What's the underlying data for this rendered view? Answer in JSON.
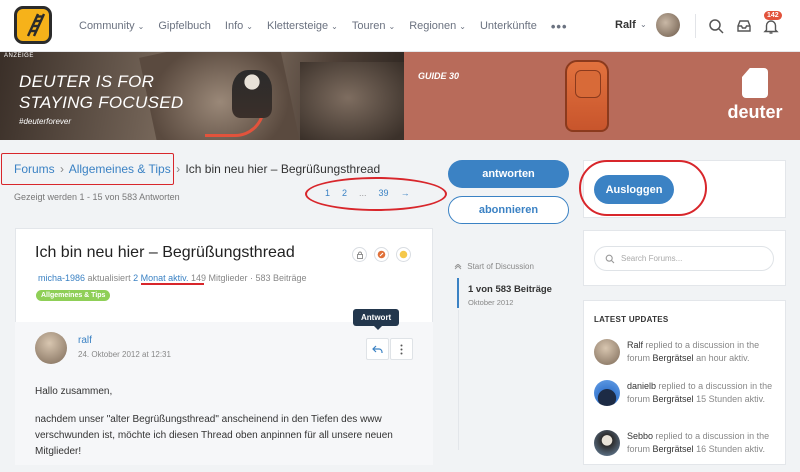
{
  "nav": {
    "items": [
      {
        "label": "Community",
        "has_chevron": true
      },
      {
        "label": "Gipfelbuch",
        "has_chevron": false
      },
      {
        "label": "Info",
        "has_chevron": true
      },
      {
        "label": "Klettersteige",
        "has_chevron": true
      },
      {
        "label": "Touren",
        "has_chevron": true
      },
      {
        "label": "Regionen",
        "has_chevron": true
      },
      {
        "label": "Unterkünfte",
        "has_chevron": false
      }
    ],
    "more": "•••",
    "user_name": "Ralf",
    "notif_count": "142",
    "icons": [
      "search-icon",
      "inbox-icon",
      "bell-icon"
    ]
  },
  "banner": {
    "ad_label": "ANZEIGE",
    "headline_line1": "DEUTER IS FOR",
    "headline_line2": "STAYING FOCUSED",
    "hashtag": "#deuterforever",
    "product": "GUIDE 30",
    "brand": "deuter"
  },
  "breadcrumb": {
    "forums": "Forums",
    "category": "Allgemeines & Tips",
    "current": "Ich bin neu hier – Begrüßungsthread",
    "sep": "›"
  },
  "listing": {
    "count_text": "Gezeigt werden 1 - 15 von 583 Antworten",
    "pages": [
      "1",
      "2",
      "...",
      "39",
      "→"
    ]
  },
  "actions": {
    "reply": "antworten",
    "subscribe": "abonnieren",
    "logout": "Ausloggen"
  },
  "thread": {
    "title": "Ich bin neu hier – Begrüßungsthread",
    "author": "micha-1986",
    "updated_prefix": "aktualisiert",
    "updated_ago": "2 Monat aktiv.",
    "members": "149 Mitglieder · 583 Beiträge",
    "tag": "Allgemeines & Tips"
  },
  "post": {
    "author": "ralf",
    "date": "24. Oktober 2012 at 12:31",
    "tooltip": "Antwort",
    "greeting": "Hallo zusammen,",
    "body": "nachdem unser \"alter Begrüßungsthread\" anscheinend in den Tiefen des www verschwunden ist, möchte ich diesen Thread oben anpinnen für all unsere neuen Mitglieder!"
  },
  "timeline": {
    "start": "Start of Discussion",
    "count": "1 von 583 Beiträge",
    "date": "Oktober 2012"
  },
  "sidebar": {
    "search_placeholder": "Search Forums...",
    "updates_title": "LATEST UPDATES",
    "updates": [
      {
        "user": "Ralf",
        "text": "replied to a discussion in the forum",
        "forum": "Bergrätsel",
        "time": "an hour aktiv."
      },
      {
        "user": "danielb",
        "text": "replied to a discussion in the forum",
        "forum": "Bergrätsel",
        "time": "15 Stunden aktiv."
      },
      {
        "user": "Sebbo",
        "text": "replied to a discussion in the forum",
        "forum": "Bergrätsel",
        "time": "16 Stunden aktiv."
      }
    ]
  },
  "colors": {
    "accent": "#3b82c4",
    "tag_green": "#8fcf57",
    "annotation_red": "#d8262b",
    "banner_right": "#b86b5a",
    "logo_yellow": "#f6b21a"
  }
}
